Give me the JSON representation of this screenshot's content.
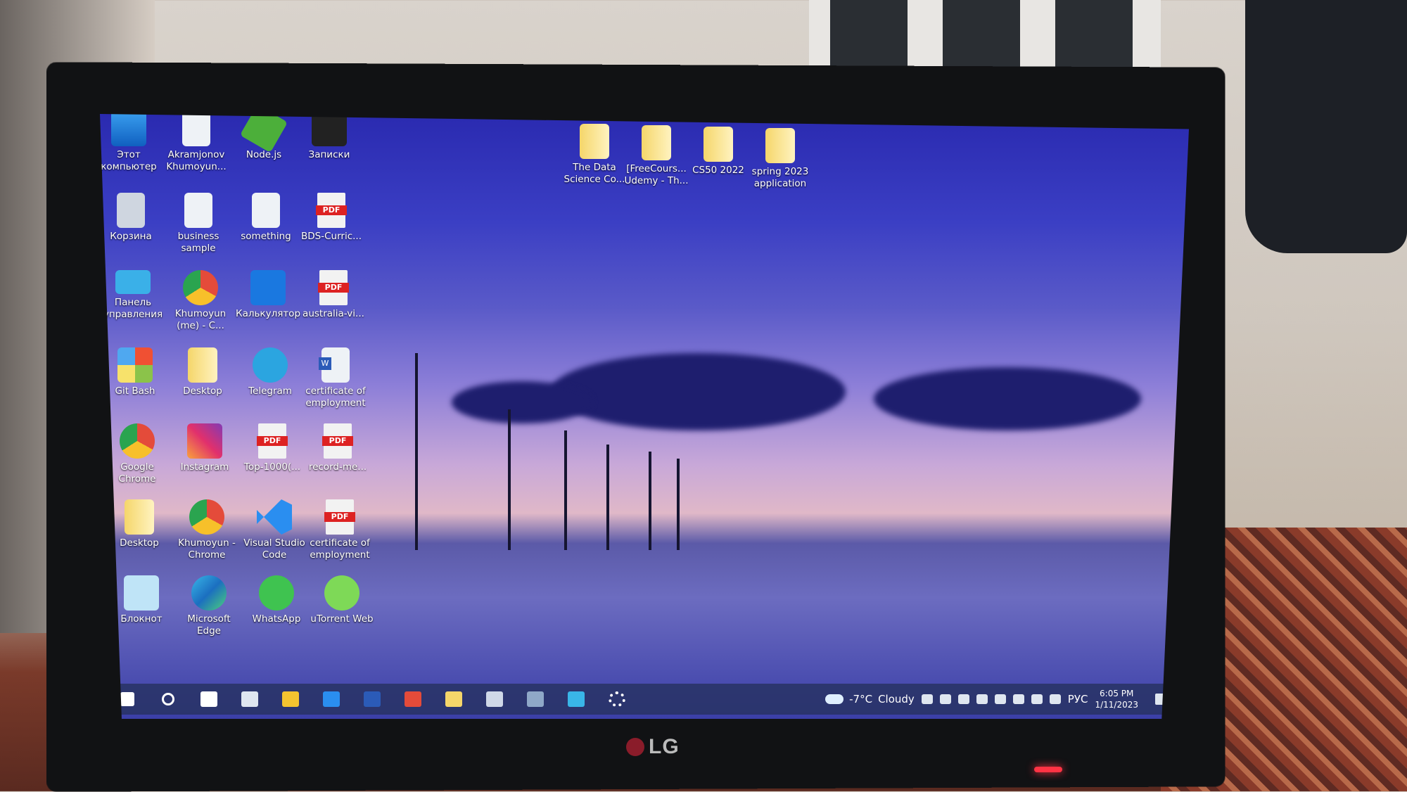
{
  "desktop": {
    "icons": [
      {
        "label": "Этот компьютер",
        "icon": "computer-icon",
        "kind": "computer"
      },
      {
        "label": "Akramjonov Khumoyun...",
        "icon": "excel-file-icon",
        "kind": "excel"
      },
      {
        "label": "Node.js",
        "icon": "nodejs-icon",
        "kind": "node"
      },
      {
        "label": "Записки",
        "icon": "sticky-notes-icon",
        "kind": "notes"
      },
      {
        "label": "Корзина",
        "icon": "recycle-bin-icon",
        "kind": "bin"
      },
      {
        "label": "business sample",
        "icon": "document-icon",
        "kind": "doc"
      },
      {
        "label": "something",
        "icon": "text-file-icon",
        "kind": "doc"
      },
      {
        "label": "BDS-Curric...",
        "icon": "pdf-icon",
        "kind": "pdf"
      },
      {
        "label": "Панель управления",
        "icon": "control-panel-icon",
        "kind": "panel"
      },
      {
        "label": "Khumoyun (me) - C...",
        "icon": "chrome-profile-icon",
        "kind": "chrome"
      },
      {
        "label": "Калькулятор",
        "icon": "calculator-icon",
        "kind": "calc"
      },
      {
        "label": "australia-vi...",
        "icon": "pdf-icon",
        "kind": "pdf"
      },
      {
        "label": "Git Bash",
        "icon": "git-bash-icon",
        "kind": "git"
      },
      {
        "label": "Desktop",
        "icon": "folder-icon",
        "kind": "folder"
      },
      {
        "label": "Telegram",
        "icon": "telegram-icon",
        "kind": "telegram"
      },
      {
        "label": "certificate of employment",
        "icon": "word-file-icon",
        "kind": "word"
      },
      {
        "label": "Google Chrome",
        "icon": "chrome-icon",
        "kind": "chrome"
      },
      {
        "label": "Instagram",
        "icon": "instagram-icon",
        "kind": "insta"
      },
      {
        "label": "Top-1000(...",
        "icon": "pdf-icon",
        "kind": "pdf"
      },
      {
        "label": "record-me...",
        "icon": "pdf-icon",
        "kind": "pdf"
      },
      {
        "label": "Desktop",
        "icon": "folder-icon",
        "kind": "folder"
      },
      {
        "label": "Khumoyun - Chrome",
        "icon": "chrome-profile-icon",
        "kind": "chrome"
      },
      {
        "label": "Visual Studio Code",
        "icon": "vscode-icon",
        "kind": "vscode"
      },
      {
        "label": "certificate of employment",
        "icon": "pdf-icon",
        "kind": "pdf"
      },
      {
        "label": "Блокнот",
        "icon": "notepad-icon",
        "kind": "notepad"
      },
      {
        "label": "Microsoft Edge",
        "icon": "edge-icon",
        "kind": "edge"
      },
      {
        "label": "WhatsApp",
        "icon": "whatsapp-icon",
        "kind": "whatsapp"
      },
      {
        "label": "uTorrent Web",
        "icon": "utorrent-icon",
        "kind": "utorrent"
      }
    ],
    "top_folders": [
      {
        "label": "The Data Science Co...",
        "icon": "folder-shortcut-icon"
      },
      {
        "label": "[FreeCours... Udemy - Th...",
        "icon": "folder-shortcut-icon"
      },
      {
        "label": "CS50 2022",
        "icon": "folder-shortcut-icon"
      },
      {
        "label": "spring 2023 application",
        "icon": "folder-shortcut-icon"
      }
    ]
  },
  "taskbar": {
    "apps": [
      {
        "name": "start",
        "icon": "windows-start-icon",
        "color": "#ffffff"
      },
      {
        "name": "search",
        "icon": "search-icon",
        "color": "#ffffff"
      },
      {
        "name": "task-view",
        "icon": "task-view-icon",
        "color": "#ffffff"
      },
      {
        "name": "store",
        "icon": "store-icon",
        "color": "#dfe6f0"
      },
      {
        "name": "file-manager",
        "icon": "file-explorer-icon",
        "color": "#f4c430"
      },
      {
        "name": "vscode",
        "icon": "vscode-icon",
        "color": "#2a8ef0"
      },
      {
        "name": "word",
        "icon": "word-icon",
        "color": "#2b5bb8"
      },
      {
        "name": "chrome",
        "icon": "chrome-icon",
        "color": "#e44b3a"
      },
      {
        "name": "explorer",
        "icon": "folder-icon",
        "color": "#f5d66a"
      },
      {
        "name": "calculator",
        "icon": "calculator-icon",
        "color": "#cfd8e8"
      },
      {
        "name": "photos",
        "icon": "photos-icon",
        "color": "#8fa8c8"
      },
      {
        "name": "edge-app",
        "icon": "edge-icon",
        "color": "#39b6e8"
      },
      {
        "name": "settings",
        "icon": "gear-icon",
        "color": "#ffffff"
      }
    ],
    "weather": {
      "temp": "-7°C",
      "condition": "Cloudy"
    },
    "tray_icons": [
      "defender-icon",
      "phone-link-icon",
      "chrome-tray-icon",
      "volume-icon",
      "notes-icon",
      "battery-icon",
      "globe-icon",
      "keyboard-icon"
    ],
    "language": "РУС",
    "time": "6:05 PM",
    "date": "1/11/2023"
  },
  "monitor": {
    "brand": "LG"
  }
}
